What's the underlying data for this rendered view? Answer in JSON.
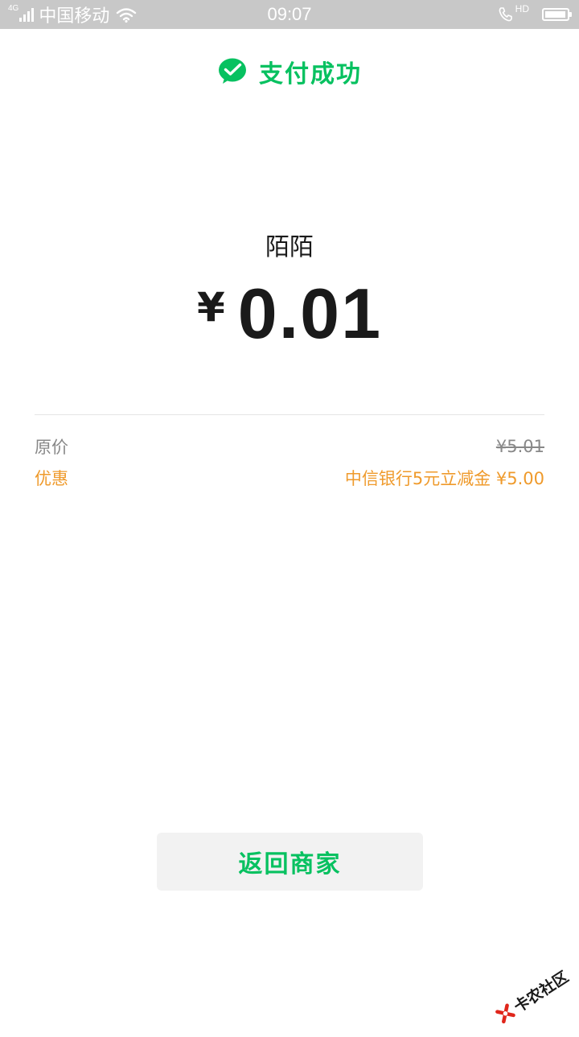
{
  "status_bar": {
    "network": "4G",
    "carrier": "中国移动",
    "time": "09:07",
    "hd_label": "HD",
    "battery_level": 0.95
  },
  "header": {
    "title": "支付成功",
    "icon": "wechat-pay-icon"
  },
  "payment": {
    "merchant": "陌陌",
    "currency": "¥",
    "amount": "0.01"
  },
  "details": {
    "original_label": "原价",
    "original_value": "¥5.01",
    "discount_label": "优惠",
    "discount_value": "中信银行5元立减金 ¥5.00"
  },
  "actions": {
    "return_label": "返回商家"
  },
  "watermark": {
    "text": "卡农社区"
  },
  "colors": {
    "brand_green": "#07c160",
    "discount_orange": "#ef9a2b",
    "status_bar_gray": "#c8c8c8"
  }
}
